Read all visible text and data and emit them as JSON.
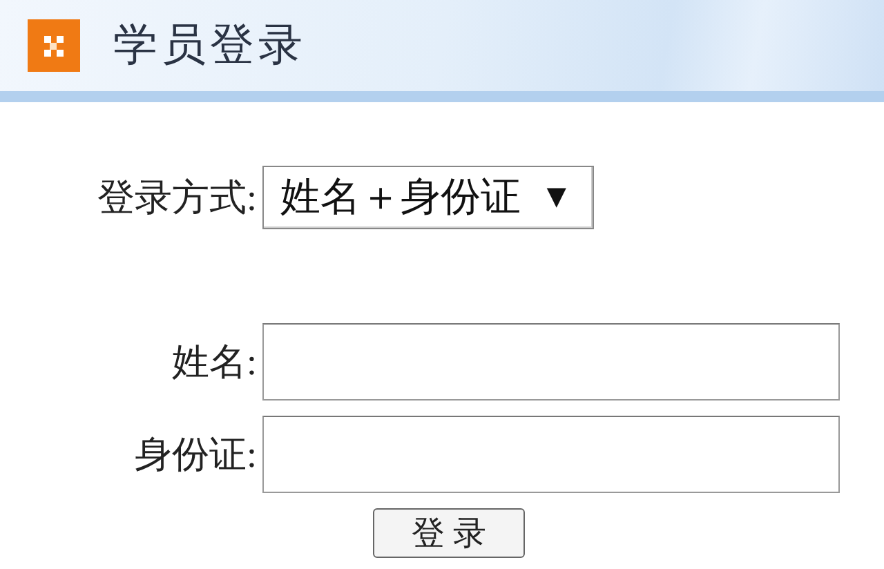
{
  "header": {
    "title": "学员登录"
  },
  "login_mode": {
    "label": "登录方式:",
    "value": "姓名＋身份证",
    "arrow": "▼"
  },
  "fields": [
    {
      "label": "姓名:"
    },
    {
      "label": "身份证:"
    }
  ],
  "submit_button": {
    "label": "登 录"
  }
}
